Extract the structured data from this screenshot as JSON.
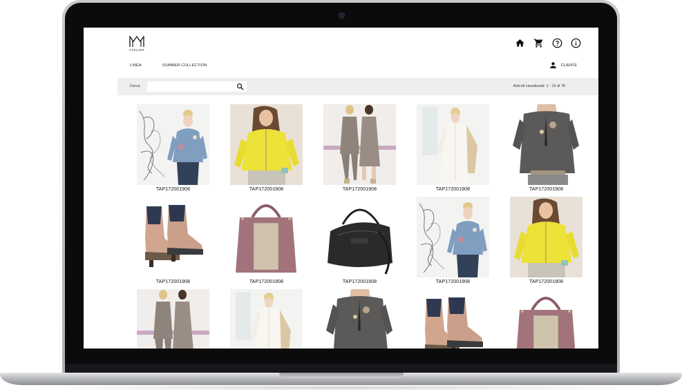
{
  "brand": {
    "logo_text": "ATELIER"
  },
  "header": {
    "icons": [
      "home-icon",
      "cart-icon",
      "help-icon",
      "info-icon"
    ],
    "nav": [
      {
        "label": "LINEA"
      },
      {
        "label": "SUMMER COLLECTION"
      }
    ],
    "user_label": "CLIENTE"
  },
  "search": {
    "label": "Cerca",
    "value": "",
    "placeholder": "",
    "results_text": "Articoli visualizzati: 1 - 16 di 78"
  },
  "products": [
    {
      "code": "TAP172001908",
      "image": "woman-blue-sweater-sketch"
    },
    {
      "code": "TAP172001908",
      "image": "woman-yellow-blouse"
    },
    {
      "code": "TAP172001908",
      "image": "two-women-grey-dresses"
    },
    {
      "code": "TAP172001908",
      "image": "woman-white-dress"
    },
    {
      "code": "TAP172001908",
      "image": "woman-grey-top"
    },
    {
      "code": "TAP172001908",
      "image": "cowboy-ankle-boots"
    },
    {
      "code": "TAP172001908",
      "image": "pink-leather-handbag"
    },
    {
      "code": "TAP172001908",
      "image": "black-leather-bag"
    },
    {
      "code": "TAP172001908",
      "image": "woman-blue-sweater-sketch"
    },
    {
      "code": "TAP172001908",
      "image": "woman-yellow-blouse"
    },
    {
      "code": "",
      "image": "two-women-grey-dresses"
    },
    {
      "code": "",
      "image": "woman-white-dress"
    },
    {
      "code": "",
      "image": "woman-grey-top"
    },
    {
      "code": "",
      "image": "cowboy-ankle-boots"
    },
    {
      "code": "",
      "image": "pink-leather-handbag"
    }
  ],
  "colors": {
    "accent_yellow": "#e6d52e",
    "search_bar_bg": "#eeeeee",
    "text": "#222222"
  }
}
